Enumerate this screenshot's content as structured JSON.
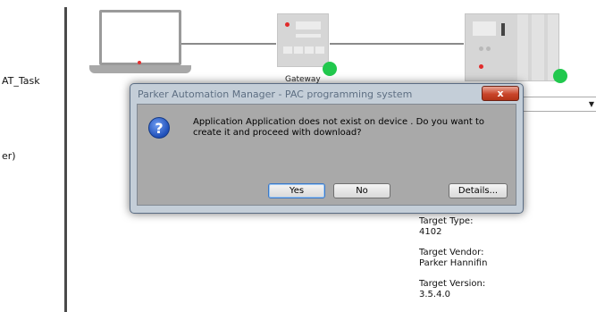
{
  "tree": {
    "items": [
      "AT_Task",
      "er)"
    ]
  },
  "diagram": {
    "gateway_label": "Gateway",
    "target_type_label": "Target Type:",
    "target_type_value": "4102",
    "target_vendor_label": "Target Vendor:",
    "target_vendor_value": "Parker Hannifin",
    "target_version_label": "Target Version:",
    "target_version_value": "3.5.4.0",
    "status_color": "#21c84d"
  },
  "dialog": {
    "title": "Parker Automation Manager - PAC programming system",
    "close_label": "x",
    "icon": "question-icon",
    "message": "Application Application does not exist on device . Do you want to create it and proceed with download?",
    "yes_label": "Yes",
    "no_label": "No",
    "details_label": "Details..."
  }
}
